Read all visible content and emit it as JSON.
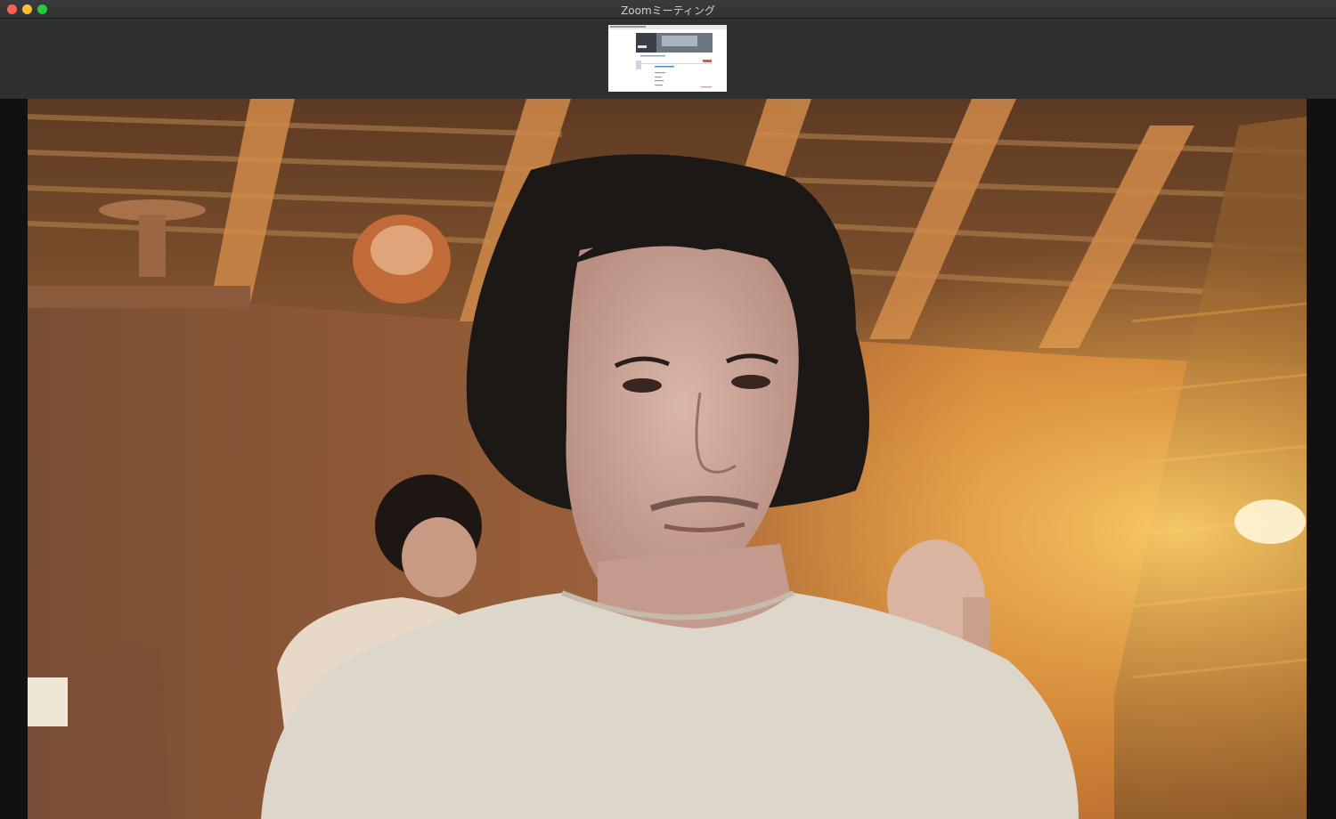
{
  "window": {
    "title": "Zoomミーティング"
  },
  "share_thumbnail": {
    "icon": "screen-share-thumbnail"
  },
  "video": {
    "icon": "participant-video"
  },
  "colors": {
    "titlebar": "#353537",
    "strip": "#2e2f31",
    "close": "#fe5f57",
    "minimize": "#febc2e",
    "maximize": "#28c840"
  }
}
